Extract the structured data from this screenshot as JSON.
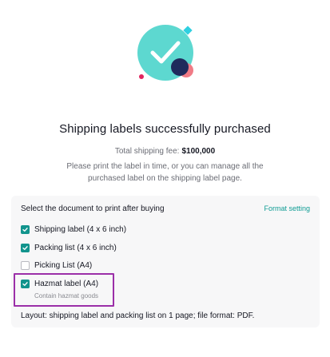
{
  "title": "Shipping labels successfully purchased",
  "fee": {
    "label": "Total shipping fee:",
    "amount": "$100,000"
  },
  "description": "Please print the label in time, or you can manage all the purchased label on the shipping label page.",
  "print_panel": {
    "title": "Select the document to print after buying",
    "format_link": "Format setting",
    "options": [
      {
        "label": "Shipping label (4 x 6 inch)",
        "checked": true
      },
      {
        "label": "Packing list (4 x 6 inch)",
        "checked": true
      },
      {
        "label": "Picking List (A4)",
        "checked": false
      },
      {
        "label": "Hazmat label (A4)",
        "checked": true,
        "sublabel": "Contain hazmat goods"
      }
    ],
    "layout_note": "Layout: shipping label and packing list on 1 page; file format: PDF."
  },
  "colors": {
    "accent": "#12948d",
    "link": "#0f9c94",
    "highlight_border": "#9b2fa8",
    "illustration_circle": "#5dd8d0",
    "illustration_navy": "#1f2a5c",
    "illustration_pink": "#f07b86"
  }
}
